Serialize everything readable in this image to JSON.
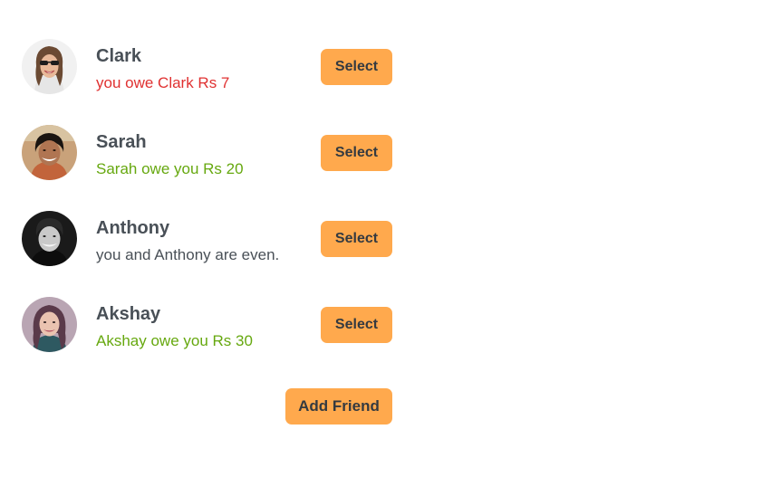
{
  "friends": [
    {
      "name": "Clark",
      "balance_text": "you owe Clark Rs 7",
      "balance_status": "owe",
      "select_label": "Select",
      "avatar_icon": "avatar-photo-clark"
    },
    {
      "name": "Sarah",
      "balance_text": "Sarah owe you Rs 20",
      "balance_status": "owed",
      "select_label": "Select",
      "avatar_icon": "avatar-photo-sarah"
    },
    {
      "name": "Anthony",
      "balance_text": "you and Anthony are even.",
      "balance_status": "even",
      "select_label": "Select",
      "avatar_icon": "avatar-photo-anthony"
    },
    {
      "name": "Akshay",
      "balance_text": "Akshay owe you Rs 30",
      "balance_status": "owed",
      "select_label": "Select",
      "avatar_icon": "avatar-photo-akshay"
    }
  ],
  "add_friend_label": "Add Friend",
  "colors": {
    "button": "#ffa94d",
    "button_text": "#343a40",
    "name_text": "#495057",
    "owe_red": "#e03131",
    "owed_green": "#66a80f",
    "even_gray": "#495057"
  }
}
